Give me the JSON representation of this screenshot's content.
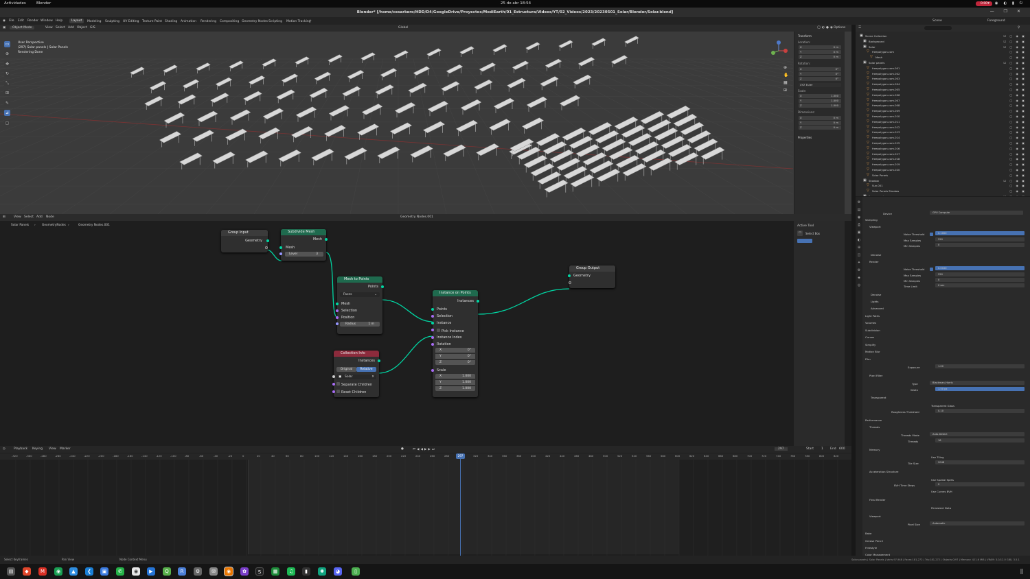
{
  "system_bar": {
    "activities": "Actividades",
    "app": "Blender",
    "clock": "25 de abr  18:54",
    "recording": "0:00"
  },
  "title": "Blender* [/home/cesarkero/HDD/D4/GoogleDrive/Proyectos/ModiEarth/01_Estructura/Videos/YT/02_Videos/2023/20230501_Solar/Blender/Solar.blend]",
  "menu": {
    "items": [
      "File",
      "Edit",
      "Render",
      "Window",
      "Help"
    ],
    "workspaces": [
      "Layout",
      "Modeling",
      "Sculpting",
      "UV Editing",
      "Texture Paint",
      "Shading",
      "Animation",
      "Rendering",
      "Compositing",
      "Geometry Nodes",
      "Scripting",
      "Motion Tracking"
    ],
    "scene": "Scene",
    "view_layer": "Foreground"
  },
  "viewport": {
    "header": {
      "mode": "Object Mode",
      "menus": [
        "View",
        "Select",
        "Add",
        "Object",
        "GIS"
      ],
      "orientation": "Global",
      "options": "Options"
    },
    "overlay": [
      "User Perspective",
      "(297) Solar panels | Solar Panels",
      "Rendering Done"
    ],
    "npanel": {
      "title": "Transform",
      "location_label": "Location:",
      "location": [
        "0 m",
        "0 m",
        "0 m"
      ],
      "rotation_label": "Rotation:",
      "rotation": [
        "0°",
        "0°",
        "0°"
      ],
      "rotation_mode": "XYZ Euler",
      "scale_label": "Scale:",
      "scale": [
        "1.000",
        "1.000",
        "1.000"
      ],
      "dimensions_label": "Dimensions:",
      "dimensions": [
        "0 m",
        "0 m",
        "0 m"
      ],
      "properties": "Properties",
      "axes": [
        "X",
        "Y",
        "Z"
      ]
    }
  },
  "node_editor": {
    "header": {
      "menus": [
        "View",
        "Select",
        "Add",
        "Node"
      ],
      "tree": "Geometry Nodes.001"
    },
    "breadcrumb": [
      "Solar Panels",
      "GeometryNodes",
      "Geometry Nodes.001"
    ],
    "nodes": {
      "group_input": {
        "title": "Group Input",
        "geometry": "Geometry"
      },
      "subdivide": {
        "title": "Subdivide Mesh",
        "mesh_out": "Mesh",
        "mesh_in": "Mesh",
        "level_label": "Level",
        "level": "3"
      },
      "mesh_to_points": {
        "title": "Mesh to Points",
        "points": "Points",
        "mode": "Faces",
        "mesh": "Mesh",
        "selection": "Selection",
        "position": "Position",
        "radius_label": "Radius",
        "radius": "1 m"
      },
      "instance_on_points": {
        "title": "Instance on Points",
        "instances": "Instances",
        "points": "Points",
        "selection": "Selection",
        "instance": "Instance",
        "pick": "Pick Instance",
        "index": "Instance Index",
        "rotation": "Rotation",
        "rot": [
          "0°",
          "0°",
          "0°"
        ],
        "scale": "Scale",
        "sc": [
          "1.000",
          "1.000",
          "1.000"
        ]
      },
      "collection_info": {
        "title": "Collection Info",
        "instances": "Instances",
        "original": "Original",
        "relative": "Relative",
        "collection": "Solar",
        "separate": "Separate Children",
        "reset": "Reset Children"
      },
      "group_output": {
        "title": "Group Output",
        "geometry": "Geometry"
      }
    },
    "side": {
      "tab": "Active Tool",
      "tool": "Select Box"
    }
  },
  "timeline": {
    "menus": [
      "Playback",
      "Keying",
      "View",
      "Marker"
    ],
    "current_frame": "297",
    "start_label": "Start",
    "start": "1",
    "end_label": "End",
    "end": "600",
    "ruler": [
      "-320",
      "-300",
      "-280",
      "-260",
      "-240",
      "-220",
      "-200",
      "-180",
      "-160",
      "-140",
      "-120",
      "-100",
      "-80",
      "-60",
      "-40",
      "-20",
      "0",
      "20",
      "40",
      "60",
      "80",
      "100",
      "120",
      "140",
      "160",
      "180",
      "200",
      "220",
      "240",
      "260",
      "280",
      "297",
      "320",
      "340",
      "360",
      "380",
      "400",
      "420",
      "440",
      "460",
      "480",
      "500",
      "520",
      "540",
      "560",
      "580",
      "600",
      "620",
      "640",
      "660",
      "680",
      "700",
      "720",
      "740",
      "760",
      "780",
      "800",
      "820"
    ]
  },
  "outliner": {
    "search_placeholder": "",
    "rows": [
      {
        "t": "Scene Collection",
        "d": 0
      },
      {
        "t": "Background",
        "d": 1
      },
      {
        "t": "Solar",
        "d": 1
      },
      {
        "t": "freepolygon.com",
        "d": 2
      },
      {
        "t": "Mesh",
        "d": 3
      },
      {
        "t": "Solar panels",
        "d": 1
      },
      {
        "t": "freepolygon.com.001",
        "d": 2
      },
      {
        "t": "freepolygon.com.002",
        "d": 2
      },
      {
        "t": "freepolygon.com.003",
        "d": 2
      },
      {
        "t": "freepolygon.com.004",
        "d": 2
      },
      {
        "t": "freepolygon.com.005",
        "d": 2
      },
      {
        "t": "freepolygon.com.006",
        "d": 2
      },
      {
        "t": "freepolygon.com.007",
        "d": 2
      },
      {
        "t": "freepolygon.com.008",
        "d": 2
      },
      {
        "t": "freepolygon.com.009",
        "d": 2
      },
      {
        "t": "freepolygon.com.010",
        "d": 2
      },
      {
        "t": "freepolygon.com.011",
        "d": 2
      },
      {
        "t": "freepolygon.com.012",
        "d": 2
      },
      {
        "t": "freepolygon.com.013",
        "d": 2
      },
      {
        "t": "freepolygon.com.014",
        "d": 2
      },
      {
        "t": "freepolygon.com.015",
        "d": 2
      },
      {
        "t": "freepolygon.com.016",
        "d": 2
      },
      {
        "t": "freepolygon.com.017",
        "d": 2
      },
      {
        "t": "freepolygon.com.018",
        "d": 2
      },
      {
        "t": "freepolygon.com.019",
        "d": 2
      },
      {
        "t": "freepolygon.com.020",
        "d": 2
      },
      {
        "t": "Solar Panels",
        "d": 2
      },
      {
        "t": "Shadow",
        "d": 1
      },
      {
        "t": "Sun.001",
        "d": 2
      },
      {
        "t": "Solar Panels Shadow",
        "d": 2
      },
      {
        "t": "Foreground",
        "d": 1
      }
    ]
  },
  "properties": {
    "device_label": "Device",
    "device": "GPU Compute",
    "sampling": "Sampling",
    "viewport": "Viewport",
    "vp_noise_label": "Noise Threshold",
    "vp_noise": "0.1000",
    "vp_max_label": "Max Samples",
    "vp_max": "250",
    "vp_min_label": "Min Samples",
    "vp_min": "0",
    "denoise": "Denoise",
    "render": "Render",
    "r_noise": "0.0100",
    "r_max": "250",
    "r_min": "0",
    "time_limit_label": "Time Limit",
    "time_limit": "0 sec",
    "denoise2": "Denoise",
    "lights": "Lights",
    "advanced": "Advanced",
    "light_paths": "Light Paths",
    "volumes": "Volumes",
    "subdivision": "Subdivision",
    "curves": "Curves",
    "simplify": "Simplify",
    "motion_blur": "Motion Blur",
    "film": "Film",
    "exposure_label": "Exposure",
    "exposure": "1.00",
    "pixel_filter": "Pixel Filter",
    "type_label": "Type",
    "type": "Blackman-Harris",
    "width_label": "Width",
    "width": "1.50 px",
    "transparent": "Transparent",
    "transparent_glass": "Transparent Glass",
    "roughness_label": "Roughness Threshold",
    "roughness": "0.10",
    "performance": "Performance",
    "threads": "Threads",
    "threads_mode_label": "Threads Mode",
    "threads_mode": "Auto-Detect",
    "threads_label": "Threads",
    "threads_val": "16",
    "memory": "Memory",
    "use_tiling": "Use Tiling",
    "tile_size_label": "Tile Size",
    "tile_size": "2048",
    "accel": "Acceleration Structure",
    "spatial": "Use Spatial Splits",
    "bvh_label": "BVH Time Steps",
    "bvh": "0",
    "curves_bvh": "Use Curves BVH",
    "final_render": "Final Render",
    "persistent": "Persistent Data",
    "viewport2": "Viewport",
    "pixel_size_label": "Pixel Size",
    "pixel_size": "Automatic",
    "bake": "Bake",
    "grease": "Grease Pencil",
    "freestyle": "Freestyle",
    "color_mgmt": "Color Management"
  },
  "status": {
    "left": "Select Keyframes",
    "mid": "Pan View",
    "right": "Node Context Menu",
    "info": "Solar panels | Solar Panels | Verts:97,948 | Faces:181,272 | Tris:181,272 | Objects:0/97 | Memory: 421.6 MiB | VRAM: 3.0/12.0 GiB | 3.5.1"
  },
  "colors": {
    "accent": "#4772b3",
    "geo_node": "#1f6a4e",
    "input_node": "#8c2b3c",
    "wire": "#00d6a3",
    "playhead": "#4772b3"
  }
}
